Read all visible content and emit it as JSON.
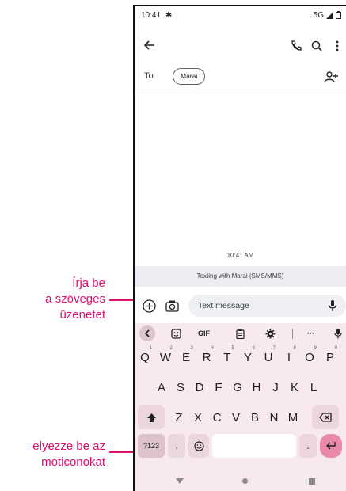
{
  "status_bar": {
    "time": "10:41",
    "network": "5G"
  },
  "compose_to": {
    "to_label": "To",
    "recipient_chip": "Marai"
  },
  "conversation": {
    "timestamp": "10:41 AM",
    "texting_info": "Texting with Marai (SMS/MMS)"
  },
  "composer": {
    "message_placeholder": "Text message"
  },
  "keyboard": {
    "toolbar": {
      "gif_label": "GIF",
      "more_label": "···"
    },
    "row1": [
      {
        "key": "Q",
        "hint": "1"
      },
      {
        "key": "W",
        "hint": "2"
      },
      {
        "key": "E",
        "hint": "3"
      },
      {
        "key": "R",
        "hint": "4"
      },
      {
        "key": "T",
        "hint": "5"
      },
      {
        "key": "Y",
        "hint": "6"
      },
      {
        "key": "U",
        "hint": "7"
      },
      {
        "key": "I",
        "hint": "8"
      },
      {
        "key": "O",
        "hint": "9"
      },
      {
        "key": "P",
        "hint": "0"
      }
    ],
    "row2": [
      "A",
      "S",
      "D",
      "F",
      "G",
      "H",
      "J",
      "K",
      "L"
    ],
    "row3": [
      "Z",
      "X",
      "C",
      "V",
      "B",
      "N",
      "M"
    ],
    "symbols_key": "?123",
    "comma_key": ",",
    "period_key": "."
  },
  "annotations": {
    "text_field_line1": "Írja be",
    "text_field_line2": "a szöveges",
    "text_field_line3": "üzenetet",
    "emoji_line1": "elyezze be az",
    "emoji_line2": "moticonokat"
  },
  "colors": {
    "accent": "#e0106f",
    "keyboard_bg": "#f7e9ee",
    "enter_key": "#e98aa8"
  }
}
